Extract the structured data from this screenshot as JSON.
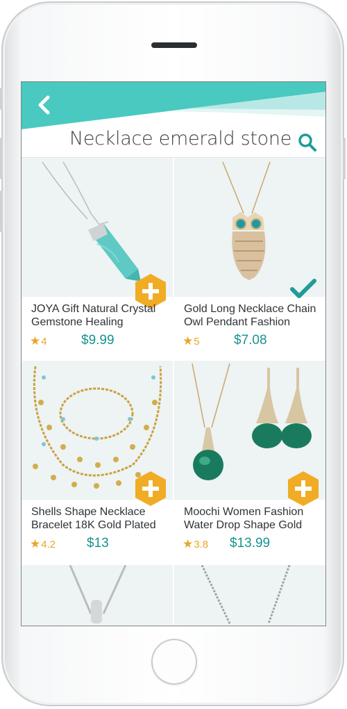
{
  "header": {
    "title": "Necklace emerald stone",
    "back_icon": "chevron-left-icon",
    "search_icon": "search-icon"
  },
  "colors": {
    "accent": "#49c9bf",
    "price": "#17938f",
    "badge": "#f0ac25",
    "star": "#e9a42a"
  },
  "products": [
    {
      "name": "JOYA Gift Natural Crystal Gemstone Healing",
      "rating": "4",
      "price": "$9.99",
      "action": "add"
    },
    {
      "name": "Gold Long Necklace Chain Owl Pendant Fashion",
      "rating": "5",
      "price": "$7.08",
      "action": "added"
    },
    {
      "name": "Shells Shape Necklace Bracelet 18K Gold Plated",
      "rating": "4.2",
      "price": "$13",
      "action": "add"
    },
    {
      "name": "Moochi Women Fashion Water Drop Shape Gold",
      "rating": "3.8",
      "price": "$13.99",
      "action": "add"
    }
  ]
}
